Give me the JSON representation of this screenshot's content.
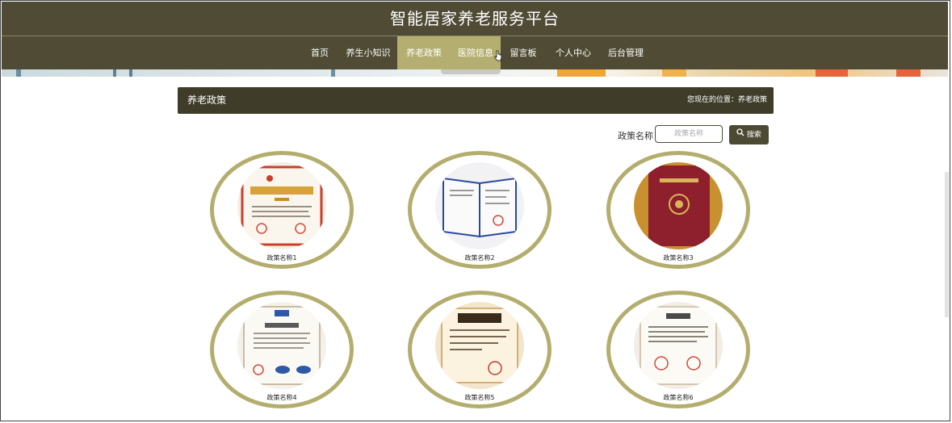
{
  "header": {
    "title": "智能居家养老服务平台"
  },
  "nav": {
    "items": [
      {
        "label": "首页"
      },
      {
        "label": "养生小知识"
      },
      {
        "label": "养老政策"
      },
      {
        "label": "医院信息"
      },
      {
        "label": "留言板"
      },
      {
        "label": "个人中心"
      },
      {
        "label": "后台管理"
      }
    ],
    "active": "养老政策"
  },
  "section": {
    "title": "养老政策",
    "location": "您现在的位置：养老政策"
  },
  "search": {
    "label": "政策名称",
    "placeholder": "政策名称",
    "button": "搜索"
  },
  "policies": [
    {
      "name": "政策名称1",
      "image": "高新技术企业证书"
    },
    {
      "name": "政策名称2",
      "image": "证书"
    },
    {
      "name": "政策名称3",
      "image": "红色证书"
    },
    {
      "name": "政策名称4",
      "image": "认证证书"
    },
    {
      "name": "政策名称5",
      "image": "荣誉证书"
    },
    {
      "name": "政策名称6",
      "image": "证书"
    }
  ],
  "colors": {
    "header": "#4f4b34",
    "active_nav": "#b4af70",
    "ring": "#b3ad6e",
    "bar": "#3f3d2a"
  }
}
